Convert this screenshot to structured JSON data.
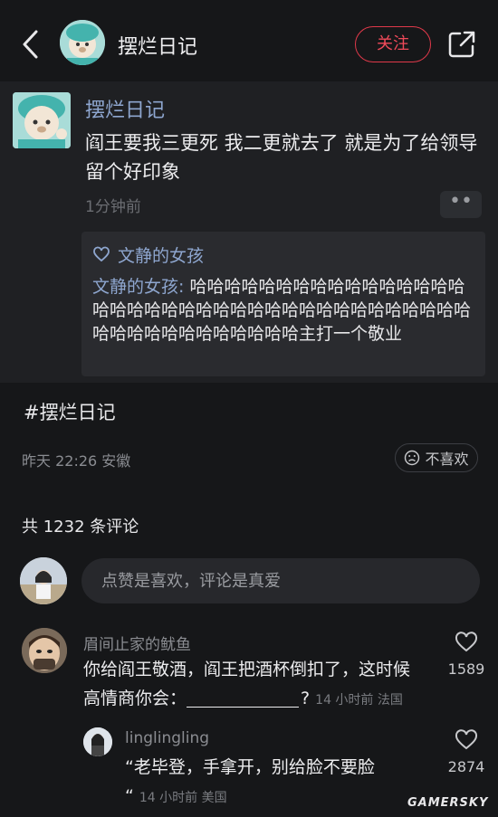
{
  "header": {
    "title": "摆烂日记",
    "follow_label": "关注"
  },
  "post": {
    "author": "摆烂日记",
    "text": "阎王要我三更死  我二更就去了  就是为了给领导留个好印象",
    "time": "1分钟前",
    "more_label": "••",
    "quote": {
      "title": "文静的女孩",
      "name": "文静的女孩:",
      "text": " 哈哈哈哈哈哈哈哈哈哈哈哈哈哈哈哈哈哈哈哈哈哈哈哈哈哈哈哈哈哈哈哈哈哈哈哈哈哈哈哈哈哈哈哈哈哈哈哈哈哈主打一个敬业"
    }
  },
  "hashtag": "#摆烂日记",
  "meta": "昨天 22:26 安徽",
  "dislike_label": "不喜欢",
  "comment_count": "共 1232 条评论",
  "comment_input": {
    "placeholder": "点赞是喜欢，评论是真爱"
  },
  "comments": [
    {
      "user": "眉间止家的鱿鱼",
      "text_line1": "你给阎王敬酒，阎王把酒杯倒扣了，这时候",
      "text_line2_prefix": "高情商你会：",
      "text_line2_suffix": "?",
      "meta": "14 小时前 法国",
      "likes": "1589"
    },
    {
      "user": "linglingling",
      "text_line1": "“老毕登，手拿开，别给脸不要脸",
      "text_line2_prefix": "“",
      "meta": "14 小时前 美国",
      "likes": "2874"
    }
  ],
  "watermark": "GAMERSKY",
  "colors": {
    "accent_red": "#e0394a",
    "link_blue": "#8ea6cf",
    "background": "#161719"
  }
}
